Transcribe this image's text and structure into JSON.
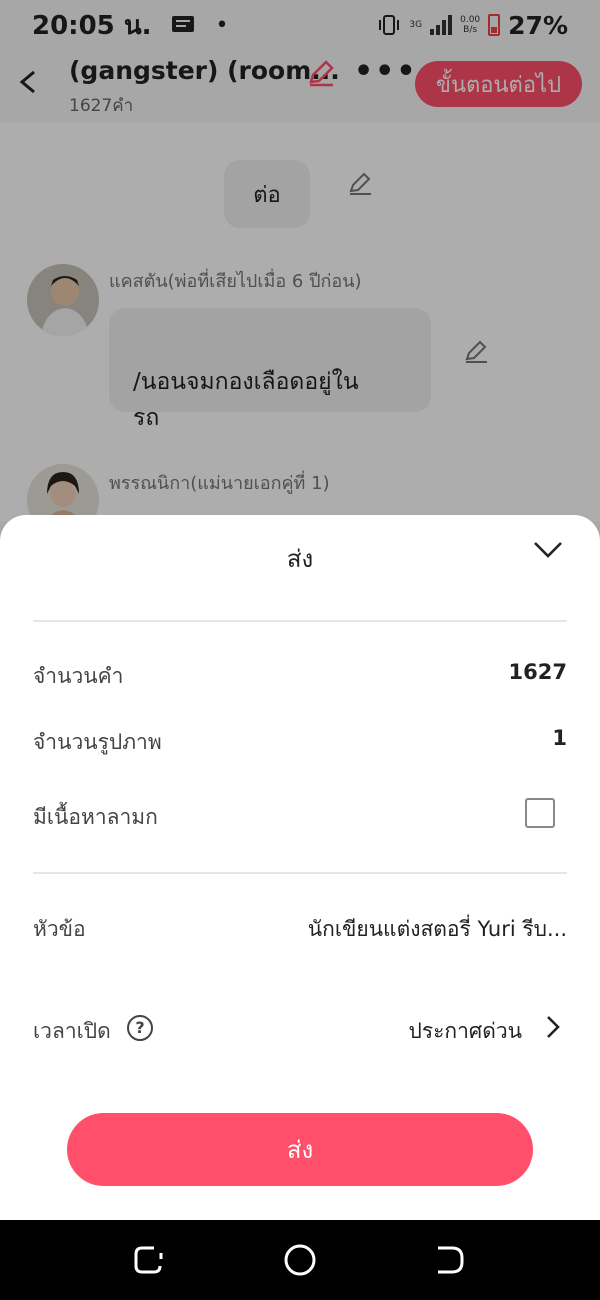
{
  "status_bar": {
    "time": "20:05 น.",
    "network": "3G",
    "speed_top": "0.00",
    "speed_bottom": "B/s",
    "battery": "27%"
  },
  "header": {
    "title": "(gangster) (room...",
    "word_count": "1627คำ",
    "next_label": "ขั้นตอนต่อไป",
    "icons": [
      "back-icon",
      "edit-icon",
      "more-icon"
    ]
  },
  "chat": {
    "narration": "ต่อ",
    "messages": [
      {
        "speaker": "แคสตัน(พ่อที่เสียไปเมื่อ 6 ปีก่อน)",
        "text": "/นอนจมกองเลือดอยู่ใน\nรถ"
      },
      {
        "speaker": "พรรณนิกา(แม่นายเอกคู่ที่ 1)",
        "text": ""
      }
    ]
  },
  "sheet": {
    "title": "ส่ง",
    "rows": {
      "word_count_label": "จำนวนคำ",
      "word_count_value": "1627",
      "image_count_label": "จำนวนรูปภาพ",
      "image_count_value": "1",
      "explicit_label": "มีเนื้อหาลามก",
      "explicit_checked": false,
      "topic_label": "หัวข้อ",
      "topic_value": "นักเขียนแต่งสตอรี่ Yuri รีบ...",
      "publish_label": "เวลาเปิด",
      "publish_value": "ประกาศด่วน"
    },
    "submit_label": "ส่ง"
  },
  "colors": {
    "accent": "#ff4f6a",
    "nav_bar": "#000000"
  }
}
